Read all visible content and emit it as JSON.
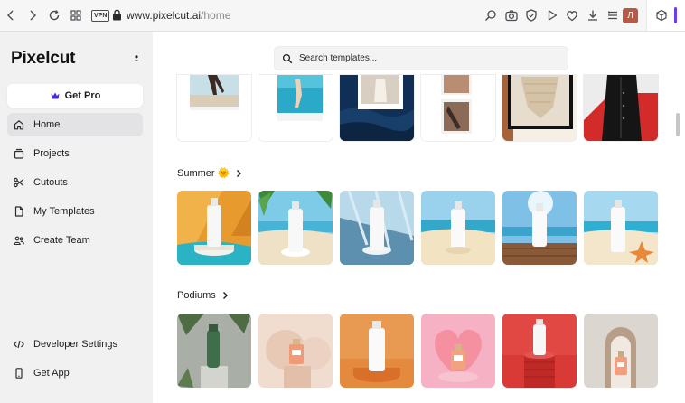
{
  "browser": {
    "vpn_label": "VPN",
    "url_host": "www.pixelcut.ai",
    "url_path": "/home",
    "profile_initial": "Л"
  },
  "sidebar": {
    "logo": "Pixelcut",
    "get_pro_label": "Get Pro",
    "items": [
      {
        "label": "Home",
        "icon": "home-icon"
      },
      {
        "label": "Projects",
        "icon": "projects-icon"
      },
      {
        "label": "Cutouts",
        "icon": "scissors-icon"
      },
      {
        "label": "My Templates",
        "icon": "file-icon"
      },
      {
        "label": "Create Team",
        "icon": "team-icon"
      }
    ],
    "bottom_items": [
      {
        "label": "Developer Settings",
        "icon": "code-icon"
      },
      {
        "label": "Get App",
        "icon": "phone-icon"
      }
    ]
  },
  "main": {
    "search_placeholder": "Search templates...",
    "sections": [
      {
        "title": "Summer 🌞"
      },
      {
        "title": "Podiums"
      }
    ]
  },
  "colors": {
    "accent": "#4b2bd9",
    "sidebar_bg": "#f1f1f2"
  }
}
